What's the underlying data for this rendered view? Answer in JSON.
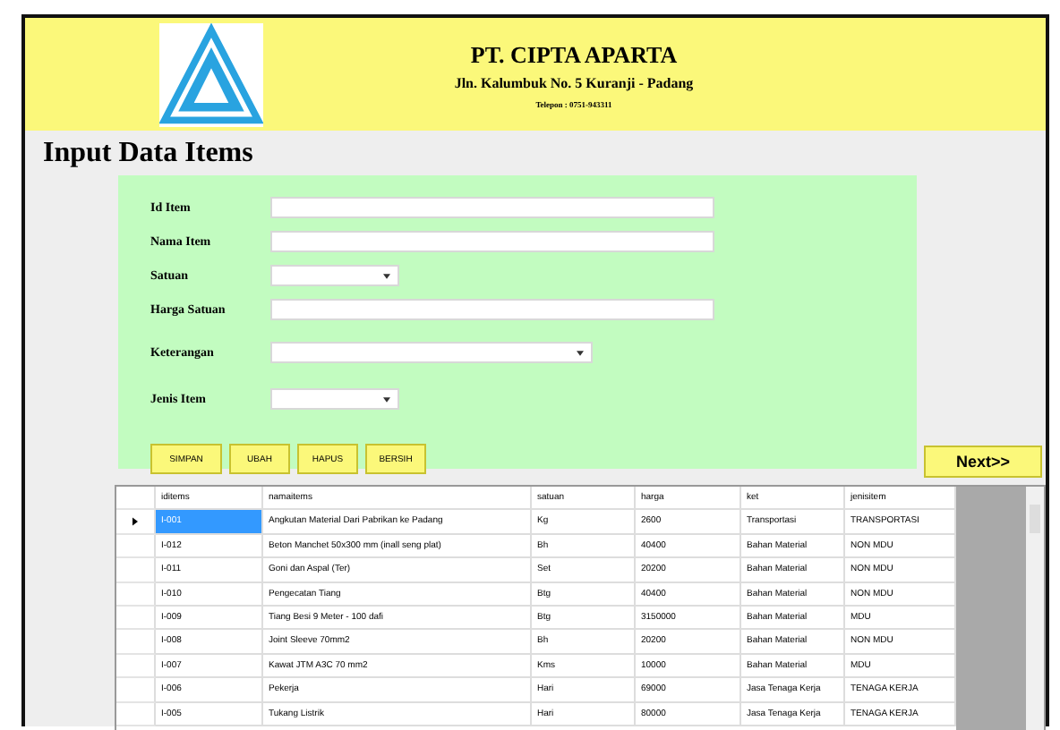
{
  "header": {
    "company": "PT. CIPTA APARTA",
    "address": "Jln. Kalumbuk No. 5 Kuranji - Padang",
    "phone": "Telepon : 0751-943311"
  },
  "page_title": "Input Data Items",
  "form": {
    "fields": [
      {
        "label": "Id Item",
        "kind": "text"
      },
      {
        "label": "Nama Item",
        "kind": "text"
      },
      {
        "label": "Satuan",
        "kind": "select"
      },
      {
        "label": "Harga Satuan",
        "kind": "text"
      },
      {
        "label": "Keterangan",
        "kind": "select"
      },
      {
        "label": "Jenis Item",
        "kind": "select"
      }
    ],
    "buttons": [
      "SIMPAN",
      "UBAH",
      "HAPUS",
      "BERSIH"
    ]
  },
  "next_button": "Next>>",
  "table": {
    "columns": [
      "iditems",
      "namaitems",
      "satuan",
      "harga",
      "ket",
      "jenisitem"
    ],
    "rows": [
      {
        "cells": [
          "I-001",
          "Angkutan Material Dari Pabrikan ke Padang",
          "Kg",
          "2600",
          "Transportasi",
          "TRANSPORTASI"
        ],
        "selected": true
      },
      {
        "cells": [
          "I-012",
          "Beton Manchet 50x300 mm (inall seng plat)",
          "Bh",
          "40400",
          "Bahan Material",
          "NON MDU"
        ],
        "selected": false
      },
      {
        "cells": [
          "I-011",
          "Goni dan Aspal (Ter)",
          "Set",
          "20200",
          "Bahan Material",
          "NON MDU"
        ],
        "selected": false
      },
      {
        "cells": [
          "I-010",
          "Pengecatan Tiang",
          "Btg",
          "40400",
          "Bahan Material",
          "NON MDU"
        ],
        "selected": false
      },
      {
        "cells": [
          "I-009",
          "Tiang Besi 9 Meter - 100 dafi",
          "Btg",
          "3150000",
          "Bahan Material",
          "MDU"
        ],
        "selected": false
      },
      {
        "cells": [
          "I-008",
          "Joint Sleeve 70mm2",
          "Bh",
          "20200",
          "Bahan Material",
          "NON MDU"
        ],
        "selected": false
      },
      {
        "cells": [
          "I-007",
          "Kawat JTM A3C 70 mm2",
          "Kms",
          "10000",
          "Bahan Material",
          "MDU"
        ],
        "selected": false
      },
      {
        "cells": [
          "I-006",
          "Pekerja",
          "Hari",
          "69000",
          "Jasa Tenaga Kerja",
          "TENAGA KERJA"
        ],
        "selected": false
      },
      {
        "cells": [
          "I-005",
          "Tukang Listrik",
          "Hari",
          "80000",
          "Jasa Tenaga Kerja",
          "TENAGA KERJA"
        ],
        "selected": false
      }
    ]
  }
}
